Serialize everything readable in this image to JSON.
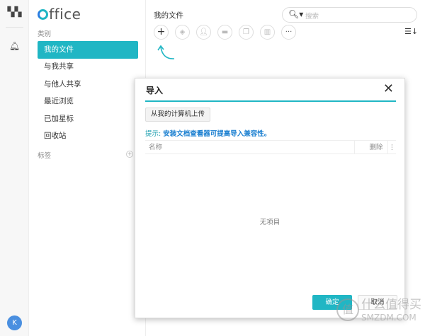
{
  "rail": {
    "apps_icon": "grid-icon",
    "notify_icon": "bell-icon",
    "avatar": "K"
  },
  "sidebar": {
    "logo": "Office",
    "category_label": "类别",
    "items": [
      {
        "label": "我的文件",
        "active": true
      },
      {
        "label": "与我共享"
      },
      {
        "label": "与他人共享"
      },
      {
        "label": "最近浏览"
      },
      {
        "label": "已加星标"
      },
      {
        "label": "回收站"
      }
    ],
    "tags_label": "标签"
  },
  "main": {
    "title": "我的文件",
    "search_placeholder": "搜索",
    "toolbar": [
      "plus-icon",
      "tag-icon",
      "add-user-icon",
      "folder-icon",
      "copy-icon",
      "trash-icon",
      "more-icon"
    ],
    "more_label": "···",
    "accent": "#20b6c4"
  },
  "dialog": {
    "title": "导入",
    "upload_button": "从我的计算机上传",
    "tip_prefix": "提示:",
    "tip_link": "安装文档查看器可提高导入兼容性。",
    "columns": [
      "名称",
      "删除"
    ],
    "empty": "无项目",
    "ok": "确定",
    "cancel": "取消"
  },
  "watermark": {
    "glyph": "值",
    "text": "什么值得买",
    "sub": "SMZDM.COM"
  }
}
